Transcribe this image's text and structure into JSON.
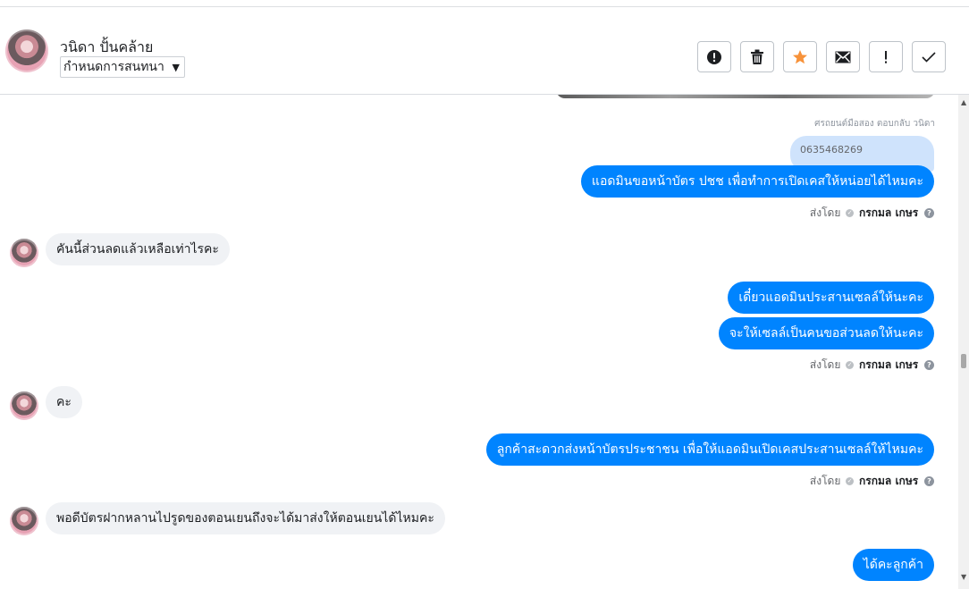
{
  "header": {
    "contact_name": "วนิดา ปั้นคล้าย",
    "assign_label": "กำหนดการสนทนา",
    "toolbar": {
      "icons": [
        "alert-circle-icon",
        "trash-icon",
        "star-icon",
        "envelope-icon",
        "exclamation-icon",
        "checkmark-icon"
      ],
      "star_color": "#f7923a"
    }
  },
  "thread": {
    "reply_context": "ศรถยนต์มือสอง ตอบกลับ วนิดา",
    "quoted_text": "0635468269",
    "messages": [
      {
        "direction": "out",
        "text": "แอดมินขอหน้าบัตร ปชช เพื่อทำการเปิดเคสให้หน่อยได้ไหมคะ"
      },
      {
        "direction": "in",
        "text": "คันนี้ส่วนลดแล้วเหลือเท่าไรคะ"
      },
      {
        "direction": "out",
        "text": "เดี๋ยวแอดมินประสานเซลล์ให้นะคะ"
      },
      {
        "direction": "out",
        "text": "จะให้เซลล์เป็นคนขอส่วนลดให้นะคะ"
      },
      {
        "direction": "in",
        "text": "คะ"
      },
      {
        "direction": "out",
        "text": "ลูกค้าสะดวกส่งหน้าบัตรประชาชน เพื่อให้แอดมินเปิดเคสประสานเซลล์ให้ไหมคะ"
      },
      {
        "direction": "in",
        "text": "พอดีบัตรฝากหลานไปรูดของตอนเยนถึงจะได้มาส่งให้ตอนเยนได้ไหมคะ"
      },
      {
        "direction": "out",
        "text": "ได้คะลูกค้า"
      }
    ],
    "sent_by": {
      "prefix": "ส่งโดย",
      "name": "กรกมล เกษร"
    }
  },
  "colors": {
    "outgoing_bubble": "#0084ff",
    "incoming_bubble": "#f0f2f5",
    "quoted_bubble": "#cfe3fc"
  }
}
